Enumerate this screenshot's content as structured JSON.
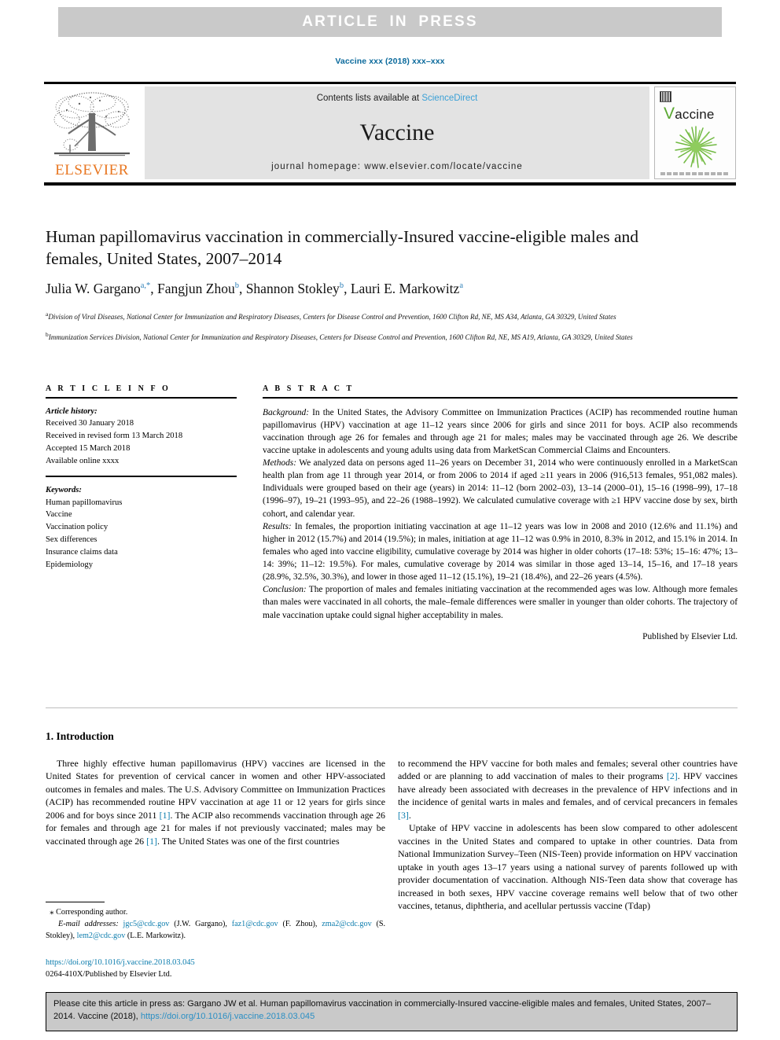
{
  "banner": {
    "text": "ARTICLE  IN  PRESS"
  },
  "running_head": {
    "text": "Vaccine xxx (2018) xxx–xxx"
  },
  "masthead": {
    "publisher_name": "ELSEVIER",
    "contents_prefix": "Contents lists available at ",
    "sciencedirect": "ScienceDirect",
    "journal_name": "Vaccine",
    "homepage": "journal homepage: www.elsevier.com/locate/vaccine",
    "cover_title_initial": "V",
    "cover_title_rest": "accine"
  },
  "article": {
    "title": "Human papillomavirus vaccination in commercially-Insured vaccine-eligible males and females, United States, 2007–2014",
    "authors_plain": "Julia W. Gargano a,*, Fangjun Zhou b, Shannon Stokley b, Lauri E. Markowitz a",
    "authors": [
      {
        "name": "Julia W. Gargano",
        "marks": "a,*"
      },
      {
        "name": "Fangjun Zhou",
        "marks": "b"
      },
      {
        "name": "Shannon Stokley",
        "marks": "b"
      },
      {
        "name": "Lauri E. Markowitz",
        "marks": "a"
      }
    ],
    "affiliations": [
      {
        "mark": "a",
        "text": "Division of Viral Diseases, National Center for Immunization and Respiratory Diseases, Centers for Disease Control and Prevention, 1600 Clifton Rd, NE, MS A34, Atlanta, GA 30329, United States"
      },
      {
        "mark": "b",
        "text": "Immunization Services Division, National Center for Immunization and Respiratory Diseases, Centers for Disease Control and Prevention, 1600 Clifton Rd, NE, MS A19, Atlanta, GA 30329, United States"
      }
    ]
  },
  "article_info": {
    "heading": "A R T I C L E   I N F O",
    "history_label": "Article history:",
    "history": [
      "Received 30 January 2018",
      "Received in revised form 13 March 2018",
      "Accepted 15 March 2018",
      "Available online xxxx"
    ],
    "keywords_label": "Keywords:",
    "keywords": [
      "Human papillomavirus",
      "Vaccine",
      "Vaccination policy",
      "Sex differences",
      "Insurance claims data",
      "Epidemiology"
    ]
  },
  "abstract": {
    "heading": "A B S T R A C T",
    "background_label": "Background:",
    "background": " In the United States, the Advisory Committee on Immunization Practices (ACIP) has recommended routine human papillomavirus (HPV) vaccination at age 11–12 years since 2006 for girls and since 2011 for boys. ACIP also recommends vaccination through age 26 for females and through age 21 for males; males may be vaccinated through age 26. We describe vaccine uptake in adolescents and young adults using data from MarketScan Commercial Claims and Encounters.",
    "methods_label": "Methods:",
    "methods": " We analyzed data on persons aged 11–26 years on December 31, 2014 who were continuously enrolled in a MarketScan health plan from age 11 through year 2014, or from 2006 to 2014 if aged ≥11 years in 2006 (916,513 females, 951,082 males). Individuals were grouped based on their age (years) in 2014: 11–12 (born 2002–03), 13–14 (2000–01), 15–16 (1998–99), 17–18 (1996–97), 19–21 (1993–95), and 22–26 (1988–1992). We calculated cumulative coverage with ≥1 HPV vaccine dose by sex, birth cohort, and calendar year.",
    "results_label": "Results:",
    "results": " In females, the proportion initiating vaccination at age 11–12 years was low in 2008 and 2010 (12.6% and 11.1%) and higher in 2012 (15.7%) and 2014 (19.5%); in males, initiation at age 11–12 was 0.9% in 2010, 8.3% in 2012, and 15.1% in 2014. In females who aged into vaccine eligibility, cumulative coverage by 2014 was higher in older cohorts (17–18: 53%; 15–16: 47%; 13–14: 39%; 11–12: 19.5%). For males, cumulative coverage by 2014 was similar in those aged 13–14, 15–16, and 17–18 years (28.9%, 32.5%, 30.3%), and lower in those aged 11–12 (15.1%), 19–21 (18.4%), and 22–26 years (4.5%).",
    "conclusion_label": "Conclusion:",
    "conclusion": " The proportion of males and females initiating vaccination at the recommended ages was low. Although more females than males were vaccinated in all cohorts, the male–female differences were smaller in younger than older cohorts. The trajectory of male vaccination uptake could signal higher acceptability in males.",
    "published_by": "Published by Elsevier Ltd."
  },
  "body": {
    "section_heading": "1. Introduction",
    "left_paragraphs": [
      "Three highly effective human papillomavirus (HPV) vaccines are licensed in the United States for prevention of cervical cancer in women and other HPV-associated outcomes in females and males. The U.S. Advisory Committee on Immunization Practices (ACIP) has recommended routine HPV vaccination at age 11 or 12 years for girls since 2006 and for boys since 2011 [1]. The ACIP also recommends vaccination through age 26 for females and through age 21 for males if not previously vaccinated; males may be vaccinated through age 26 [1]. The United States was one of the first countries"
    ],
    "right_paragraphs": [
      "to recommend the HPV vaccine for both males and females; several other countries have added or are planning to add vaccination of males to their programs [2]. HPV vaccines have already been associated with decreases in the prevalence of HPV infections and in the incidence of genital warts in males and females, and of cervical precancers in females [3].",
      "Uptake of HPV vaccine in adolescents has been slow compared to other adolescent vaccines in the United States and compared to uptake in other countries. Data from National Immunization Survey–Teen (NIS-Teen) provide information on HPV vaccination uptake in youth ages 13–17 years using a national survey of parents followed up with provider documentation of vaccination. Although NIS-Teen data show that coverage has increased in both sexes, HPV vaccine coverage remains well below that of two other vaccines, tetanus, diphtheria, and acellular pertussis vaccine (Tdap)"
    ]
  },
  "footnote": {
    "corresponding": "Corresponding author.",
    "email_label": "E-mail addresses:",
    "emails": [
      {
        "address": "jgc5@cdc.gov",
        "owner": "(J.W. Gargano)"
      },
      {
        "address": "faz1@cdc.gov",
        "owner": "(F. Zhou)"
      },
      {
        "address": "zma2@cdc.gov",
        "owner": "(S. Stokley)"
      },
      {
        "address": "lem2@cdc.gov",
        "owner": "(L.E. Markowitz)"
      }
    ],
    "doi": "https://doi.org/10.1016/j.vaccine.2018.03.045",
    "issn_line": "0264-410X/Published by Elsevier Ltd."
  },
  "cite_box": {
    "text_before_doi": "Please cite this article in press as: Gargano JW et al. Human papillomavirus vaccination in commercially-Insured vaccine-eligible males and females, United States, 2007–2014. Vaccine (2018), ",
    "doi": "https://doi.org/10.1016/j.vaccine.2018.03.045"
  },
  "colors": {
    "link_blue": "#0b7cad",
    "sciencedirect_blue": "#3aa0d6",
    "elsevier_orange": "#e87722",
    "banner_gray": "#c9c9c9",
    "masthead_gray": "#e3e3e3",
    "cover_green": "#5aa832"
  }
}
